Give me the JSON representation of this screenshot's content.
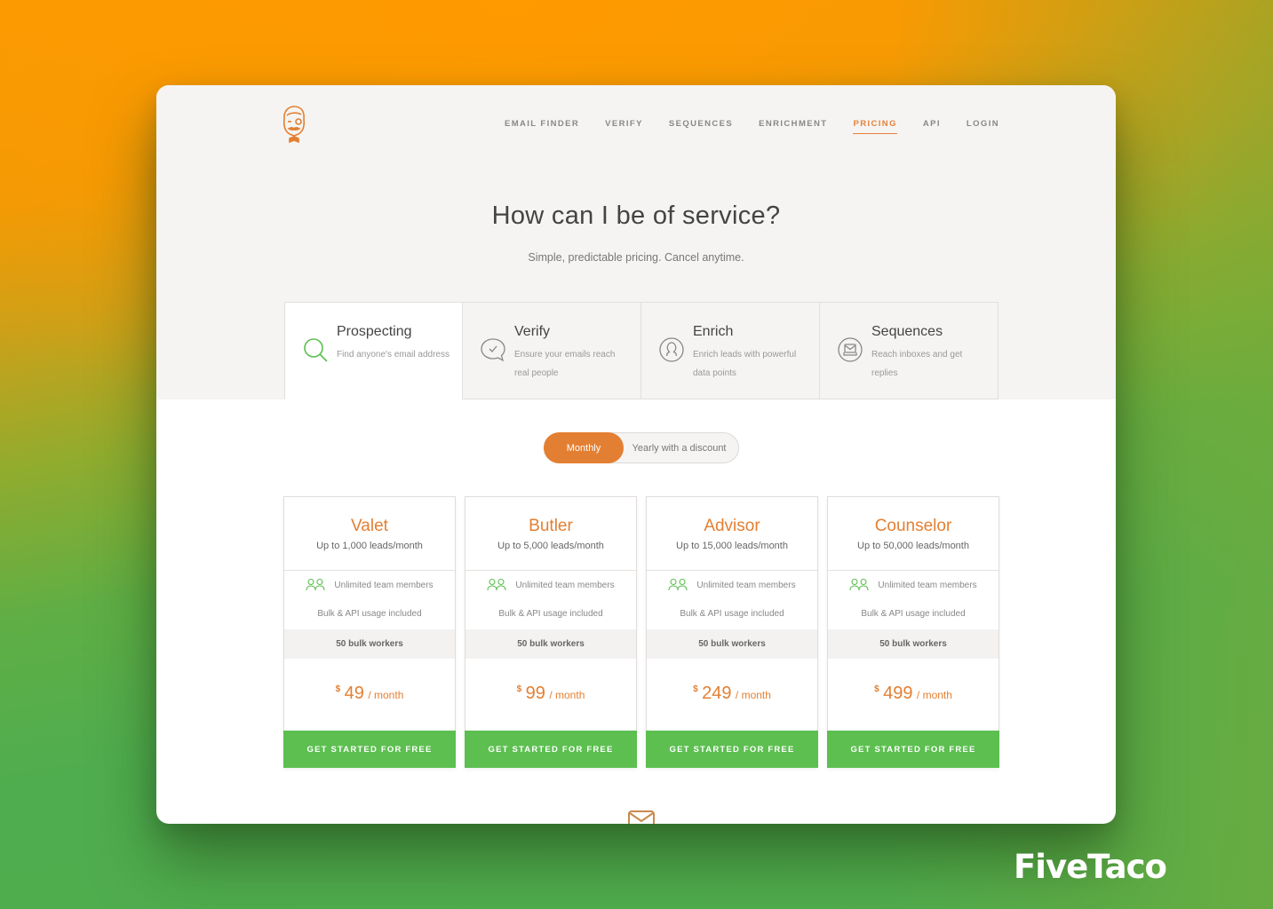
{
  "nav": {
    "items": [
      {
        "label": "EMAIL FINDER",
        "active": false
      },
      {
        "label": "VERIFY",
        "active": false
      },
      {
        "label": "SEQUENCES",
        "active": false
      },
      {
        "label": "ENRICHMENT",
        "active": false
      },
      {
        "label": "PRICING",
        "active": true
      },
      {
        "label": "API",
        "active": false
      },
      {
        "label": "LOGIN",
        "active": false
      }
    ]
  },
  "logo": {
    "icon": "butler-mascot-icon"
  },
  "hero": {
    "title": "How can I be of service?",
    "subtitle": "Simple, predictable pricing. Cancel anytime."
  },
  "products": [
    {
      "name": "Prospecting",
      "desc": "Find anyone's email address",
      "icon": "search-icon",
      "active": true
    },
    {
      "name": "Verify",
      "desc": "Ensure your emails reach real people",
      "icon": "chat-check-icon",
      "active": false
    },
    {
      "name": "Enrich",
      "desc": "Enrich leads with powerful data points",
      "icon": "user-circle-icon",
      "active": false
    },
    {
      "name": "Sequences",
      "desc": "Reach inboxes and get replies",
      "icon": "inbox-icon",
      "active": false
    }
  ],
  "billing_toggle": {
    "options": [
      "Monthly",
      "Yearly with a discount"
    ],
    "selected": "Monthly"
  },
  "plans": [
    {
      "name": "Valet",
      "leads": "Up to 1,000 leads/month",
      "feature1": "Unlimited team members",
      "feature2": "Bulk & API usage included",
      "workers": "50 bulk workers",
      "currency": "$",
      "price": "49",
      "period": "/ month",
      "cta": "GET STARTED FOR FREE"
    },
    {
      "name": "Butler",
      "leads": "Up to 5,000 leads/month",
      "feature1": "Unlimited team members",
      "feature2": "Bulk & API usage included",
      "workers": "50 bulk workers",
      "currency": "$",
      "price": "99",
      "period": "/ month",
      "cta": "GET STARTED FOR FREE"
    },
    {
      "name": "Advisor",
      "leads": "Up to 15,000 leads/month",
      "feature1": "Unlimited team members",
      "feature2": "Bulk & API usage included",
      "workers": "50 bulk workers",
      "currency": "$",
      "price": "249",
      "period": "/ month",
      "cta": "GET STARTED FOR FREE"
    },
    {
      "name": "Counselor",
      "leads": "Up to 50,000 leads/month",
      "feature1": "Unlimited team members",
      "feature2": "Bulk & API usage included",
      "workers": "50 bulk workers",
      "currency": "$",
      "price": "499",
      "period": "/ month",
      "cta": "GET STARTED FOR FREE"
    }
  ],
  "colors": {
    "accent": "#e37f32",
    "cta": "#5cbf50",
    "icon_green": "#5cbf50"
  },
  "watermark": {
    "text": "FiveTaco"
  }
}
